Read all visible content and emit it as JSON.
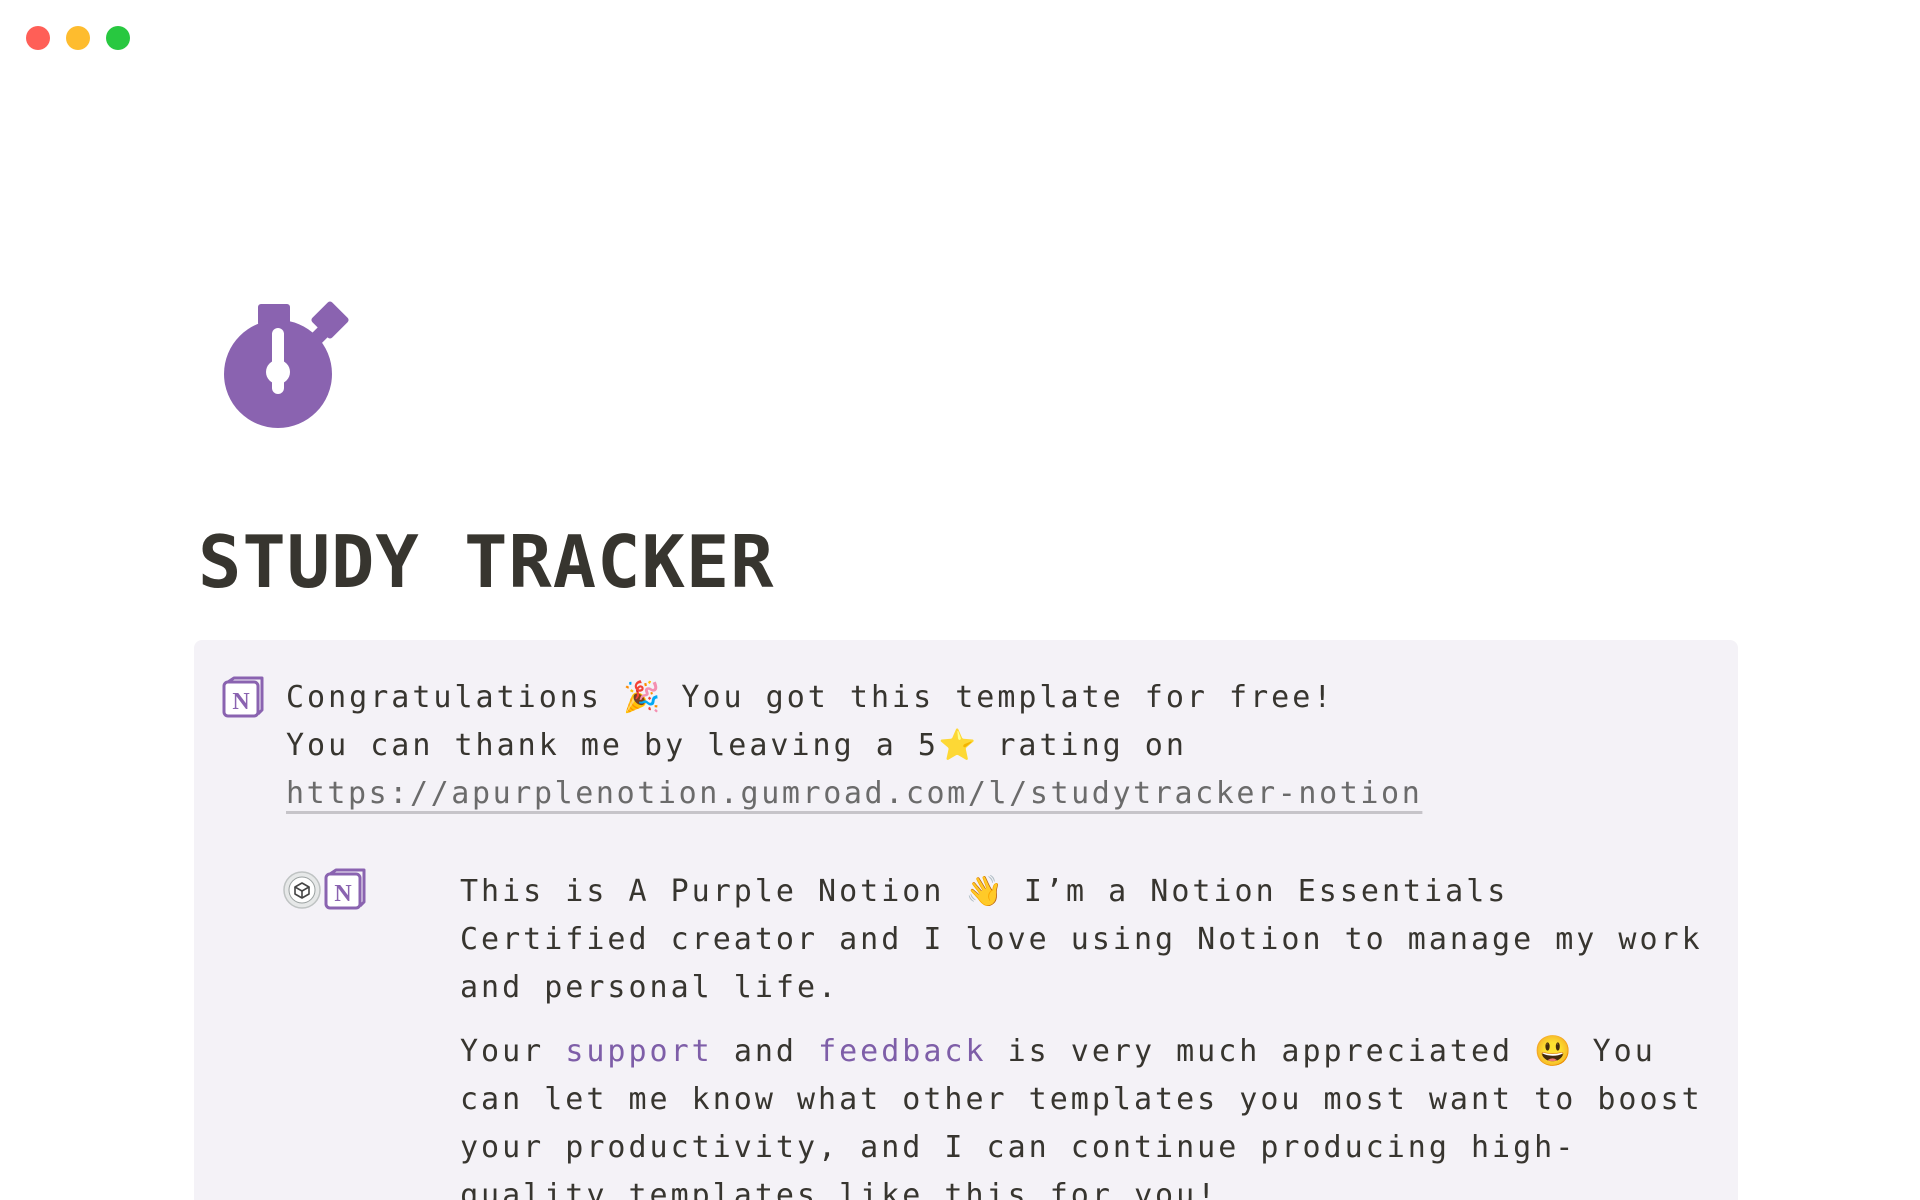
{
  "window": {
    "controls": [
      "close",
      "minimize",
      "maximize"
    ]
  },
  "page": {
    "icon": "stopwatch-icon",
    "title": "STUDY TRACKER"
  },
  "callout": {
    "icon": "notion-logo-icon",
    "line1_before": "Congratulations",
    "line1_emoji": "🎉",
    "line1_after": "You got this template for free!",
    "line2_before": "You can thank me by leaving a 5",
    "line2_emoji": "⭐",
    "line2_after": "rating on",
    "link": "https://apurplenotion.gumroad.com/l/studytracker-notion"
  },
  "intro": {
    "icons": [
      "certified-badge-icon",
      "notion-logo-icon"
    ],
    "para1_before": "This is A Purple Notion",
    "para1_emoji": "👋",
    "para1_after": "I’m a Notion Essentials Certified creator and I love using Notion to manage my work and personal life.",
    "para2_start": "Your",
    "support_link": "support",
    "para2_and": "and",
    "feedback_link": "feedback",
    "para2_mid": "is very much appreciated",
    "para2_emoji": "😃",
    "para2_end": "You can let me know what other templates you most want to boost your productivity, and I can continue producing high-quality templates like this for you!"
  },
  "colors": {
    "accent": "#8a63b0",
    "link_purple": "#7e5ea8",
    "callout_bg": "#f4f2f7",
    "text": "#37352f"
  }
}
